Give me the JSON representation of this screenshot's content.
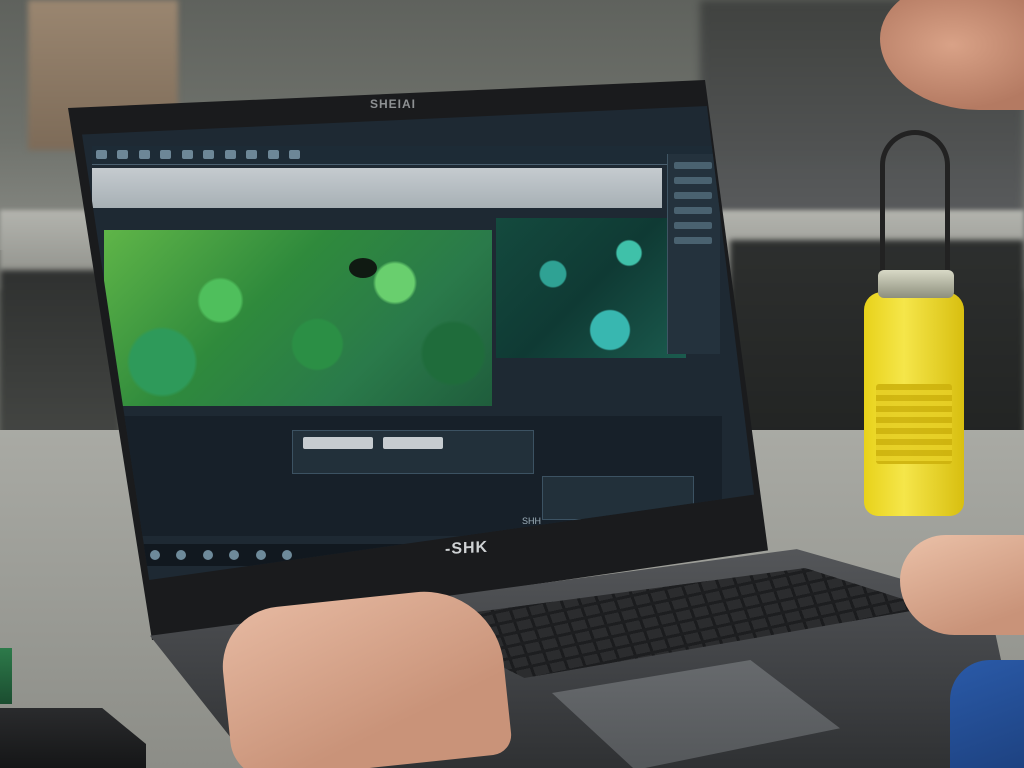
{
  "scene": {
    "lid_top_brand": "SHEIAI",
    "laptop_brand": "-SHK",
    "screen": {
      "status_text": "SHH"
    }
  },
  "colors": {
    "bottle": "#f0dc35",
    "screen_bg": "#1e2933",
    "foliage": "#3a9a48"
  }
}
